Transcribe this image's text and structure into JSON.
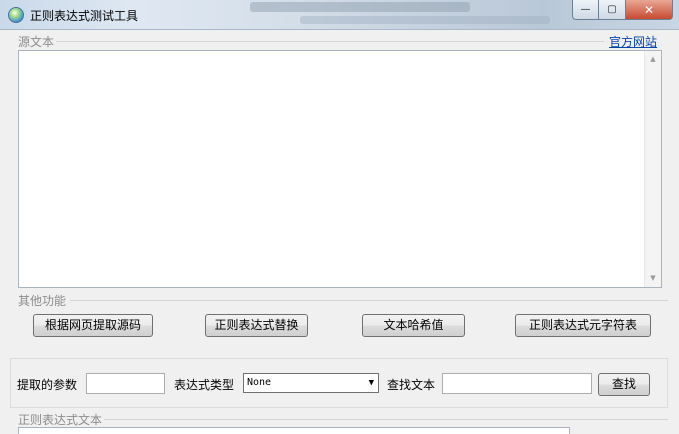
{
  "window": {
    "title": "正则表达式测试工具",
    "buttons": {
      "minimize": "—",
      "maximize": "▢",
      "close": "✕"
    }
  },
  "source": {
    "group_label": "源文本",
    "link_label": "官方网站",
    "text": ""
  },
  "functions": {
    "group_label": "其他功能",
    "buttons": [
      "根据网页提取源码",
      "正则表达式替换",
      "文本哈希值",
      "正则表达式元字符表"
    ]
  },
  "search": {
    "param_label": "提取的参数",
    "param_value": "",
    "type_label": "表达式类型",
    "type_selected": "None",
    "find_label": "查找文本",
    "find_value": "",
    "find_button": "查找"
  },
  "regex": {
    "group_label": "正则表达式文本"
  }
}
